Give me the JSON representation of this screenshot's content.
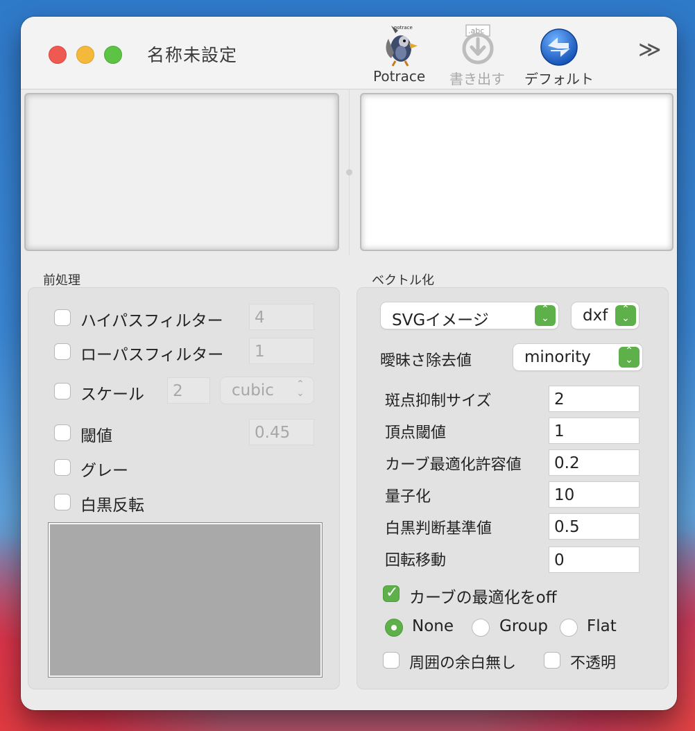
{
  "window": {
    "title": "名称未設定"
  },
  "toolbar": {
    "potrace_label": "Potrace",
    "export_label": "書き出す",
    "default_label": "デフォルト",
    "overflow_glyph": "≫"
  },
  "preprocess": {
    "title": "前処理",
    "highpass": {
      "label": "ハイパスフィルター",
      "value": "4",
      "checked": false
    },
    "lowpass": {
      "label": "ローパスフィルター",
      "value": "1",
      "checked": false
    },
    "scale": {
      "label": "スケール",
      "value": "2",
      "mode": "cubic",
      "checked": false
    },
    "threshold": {
      "label": "閾値",
      "value": "0.45",
      "checked": false
    },
    "gray": {
      "label": "グレー",
      "checked": false
    },
    "invert": {
      "label": "白黒反転",
      "checked": false
    }
  },
  "vectorize": {
    "title": "ベクトル化",
    "format": "SVGイメージ",
    "format_ext": "dxf",
    "ambiguity_label": "曖昧さ除去値",
    "ambiguity_value": "minority",
    "params": [
      {
        "label": "斑点抑制サイズ",
        "value": "2"
      },
      {
        "label": "頂点閾値",
        "value": "1"
      },
      {
        "label": "カーブ最適化許容値",
        "value": "0.2"
      },
      {
        "label": "量子化",
        "value": "10"
      },
      {
        "label": "白黒判断基準値",
        "value": "0.5"
      },
      {
        "label": "回転移動",
        "value": "0"
      }
    ],
    "curve_opt_off": {
      "label": "カーブの最適化をoff",
      "checked": true
    },
    "grouping": {
      "options": [
        "None",
        "Group",
        "Flat"
      ],
      "selected": "None"
    },
    "no_margin": {
      "label": "周囲の余白無し",
      "checked": false
    },
    "opaque": {
      "label": "不透明",
      "checked": false
    }
  },
  "colors": {
    "accent": "#5eb04a",
    "close": "#ee5a52",
    "minimize": "#f4b83a",
    "zoom": "#5cc345"
  }
}
